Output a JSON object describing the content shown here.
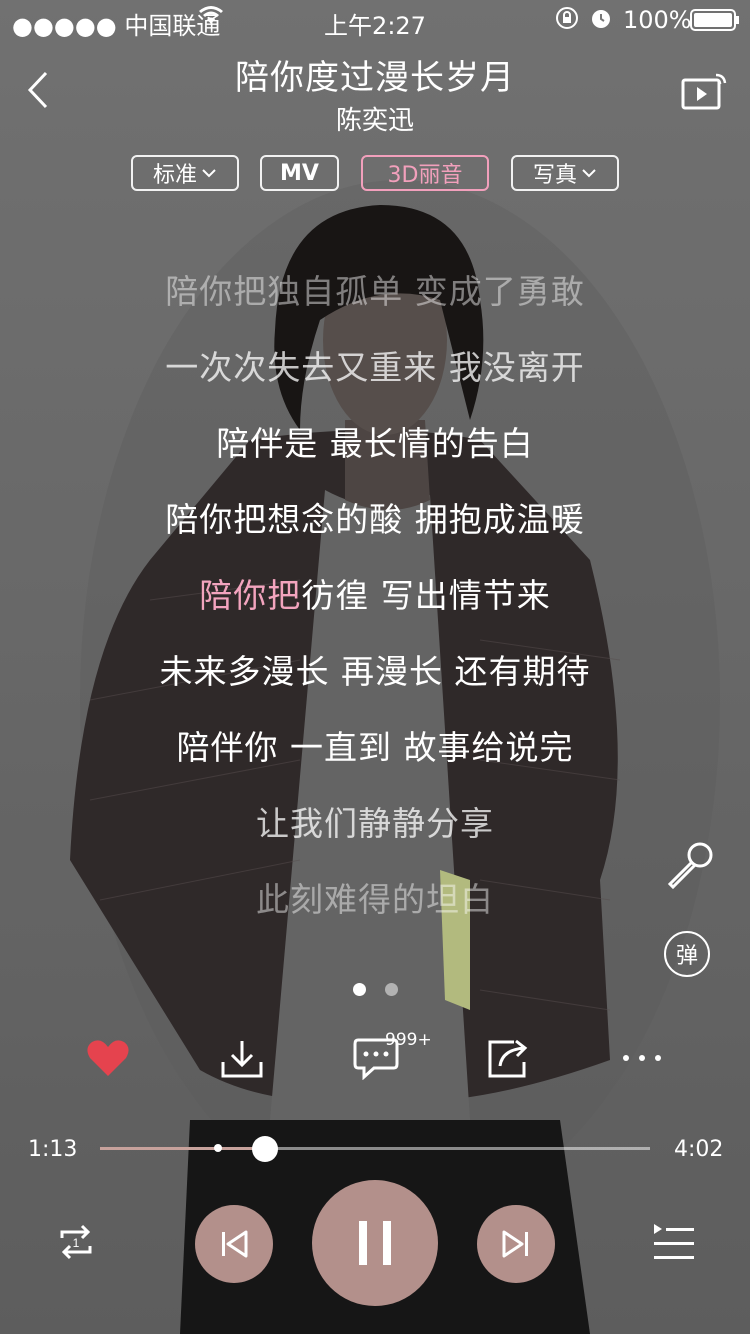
{
  "status_bar": {
    "carrier": "●●●●● 中国联通",
    "time": "上午2:27",
    "battery": "100%"
  },
  "header": {
    "title": "陪你度过漫长岁月",
    "artist": "陈奕迅"
  },
  "quality_tabs": [
    {
      "label": "标准",
      "has_dropdown": true,
      "active": false
    },
    {
      "label": "MV",
      "has_dropdown": false,
      "active": false
    },
    {
      "label": "3D丽音",
      "has_dropdown": false,
      "active": true
    },
    {
      "label": "写真",
      "has_dropdown": true,
      "active": false
    }
  ],
  "lyrics": {
    "lines": [
      "陪你把独自孤单 变成了勇敢",
      "一次次失去又重来 我没离开",
      "陪伴是 最长情的告白",
      "陪你把想念的酸 拥抱成温暖",
      "陪你把彷徨 写出情节来",
      "未来多漫长 再漫长 还有期待",
      "陪伴你 一直到 故事给说完",
      "让我们静静分享",
      "此刻难得的坦白"
    ],
    "current_line_sung": "陪你把",
    "current_line_rest": "彷徨 写出情节来"
  },
  "side_controls": {
    "danmaku_label": "弹"
  },
  "actions": {
    "comment_count": "999+"
  },
  "player": {
    "elapsed": "1:13",
    "duration": "4:02",
    "progress": 0.3
  },
  "colors": {
    "accent_pink": "#f3a4be",
    "heart_red": "#e5434e",
    "control_bg": "#b3908b"
  }
}
